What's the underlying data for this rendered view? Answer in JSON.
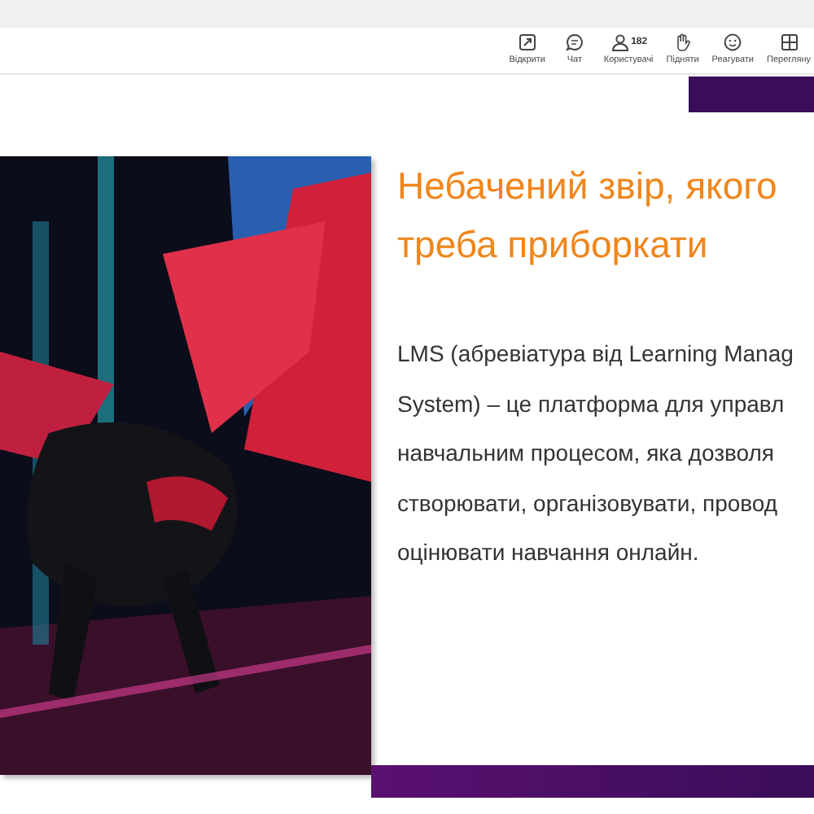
{
  "toolbar": {
    "items": [
      {
        "kind": "share",
        "label": "Відкрити"
      },
      {
        "kind": "chat",
        "label": "Чат"
      },
      {
        "kind": "people",
        "label": "Користувачі",
        "count": "182"
      },
      {
        "kind": "hand",
        "label": "Підняти"
      },
      {
        "kind": "react",
        "label": "Реагувати"
      },
      {
        "kind": "grid",
        "label": "Перегляну"
      }
    ]
  },
  "slide": {
    "title_lines": [
      "Небачений звір, якого",
      "треба приборкати"
    ],
    "body_lines": [
      "LMS (абревіатура від Learning Manag",
      "System) – це платформа для управл",
      "навчальним процесом, яка дозволя",
      "створювати, організовувати, провод",
      "оцінювати навчання онлайн."
    ],
    "image": {
      "kind": "picture"
    }
  }
}
